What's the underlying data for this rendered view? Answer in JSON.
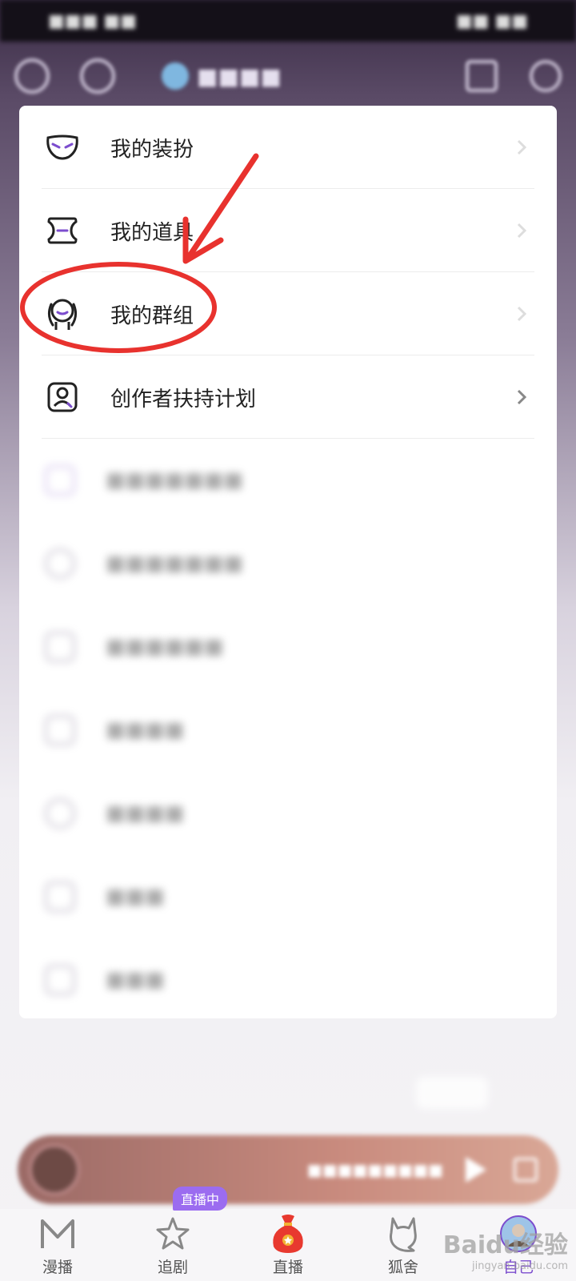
{
  "menu": {
    "items": [
      {
        "label": "我的装扮",
        "icon": "mask-icon"
      },
      {
        "label": "我的道具",
        "icon": "ticket-icon"
      },
      {
        "label": "我的群组",
        "icon": "group-icon"
      },
      {
        "label": "创作者扶持计划",
        "icon": "creator-icon"
      }
    ]
  },
  "tabbar": {
    "tabs": [
      {
        "label": "漫播",
        "icon": "m-logo-icon"
      },
      {
        "label": "追剧",
        "icon": "star-icon",
        "badge": "直播中"
      },
      {
        "label": "直播",
        "icon": "lucky-bag-icon"
      },
      {
        "label": "狐舍",
        "icon": "fox-icon"
      },
      {
        "label": "自己",
        "icon": "avatar-icon",
        "active": true
      }
    ]
  },
  "watermark": {
    "brand": "Baidu经验",
    "url": "jingyan.baidu.com"
  },
  "colors": {
    "accent": "#7c4dce",
    "annotation": "#e8322e",
    "badge": "#9b6cf0"
  }
}
